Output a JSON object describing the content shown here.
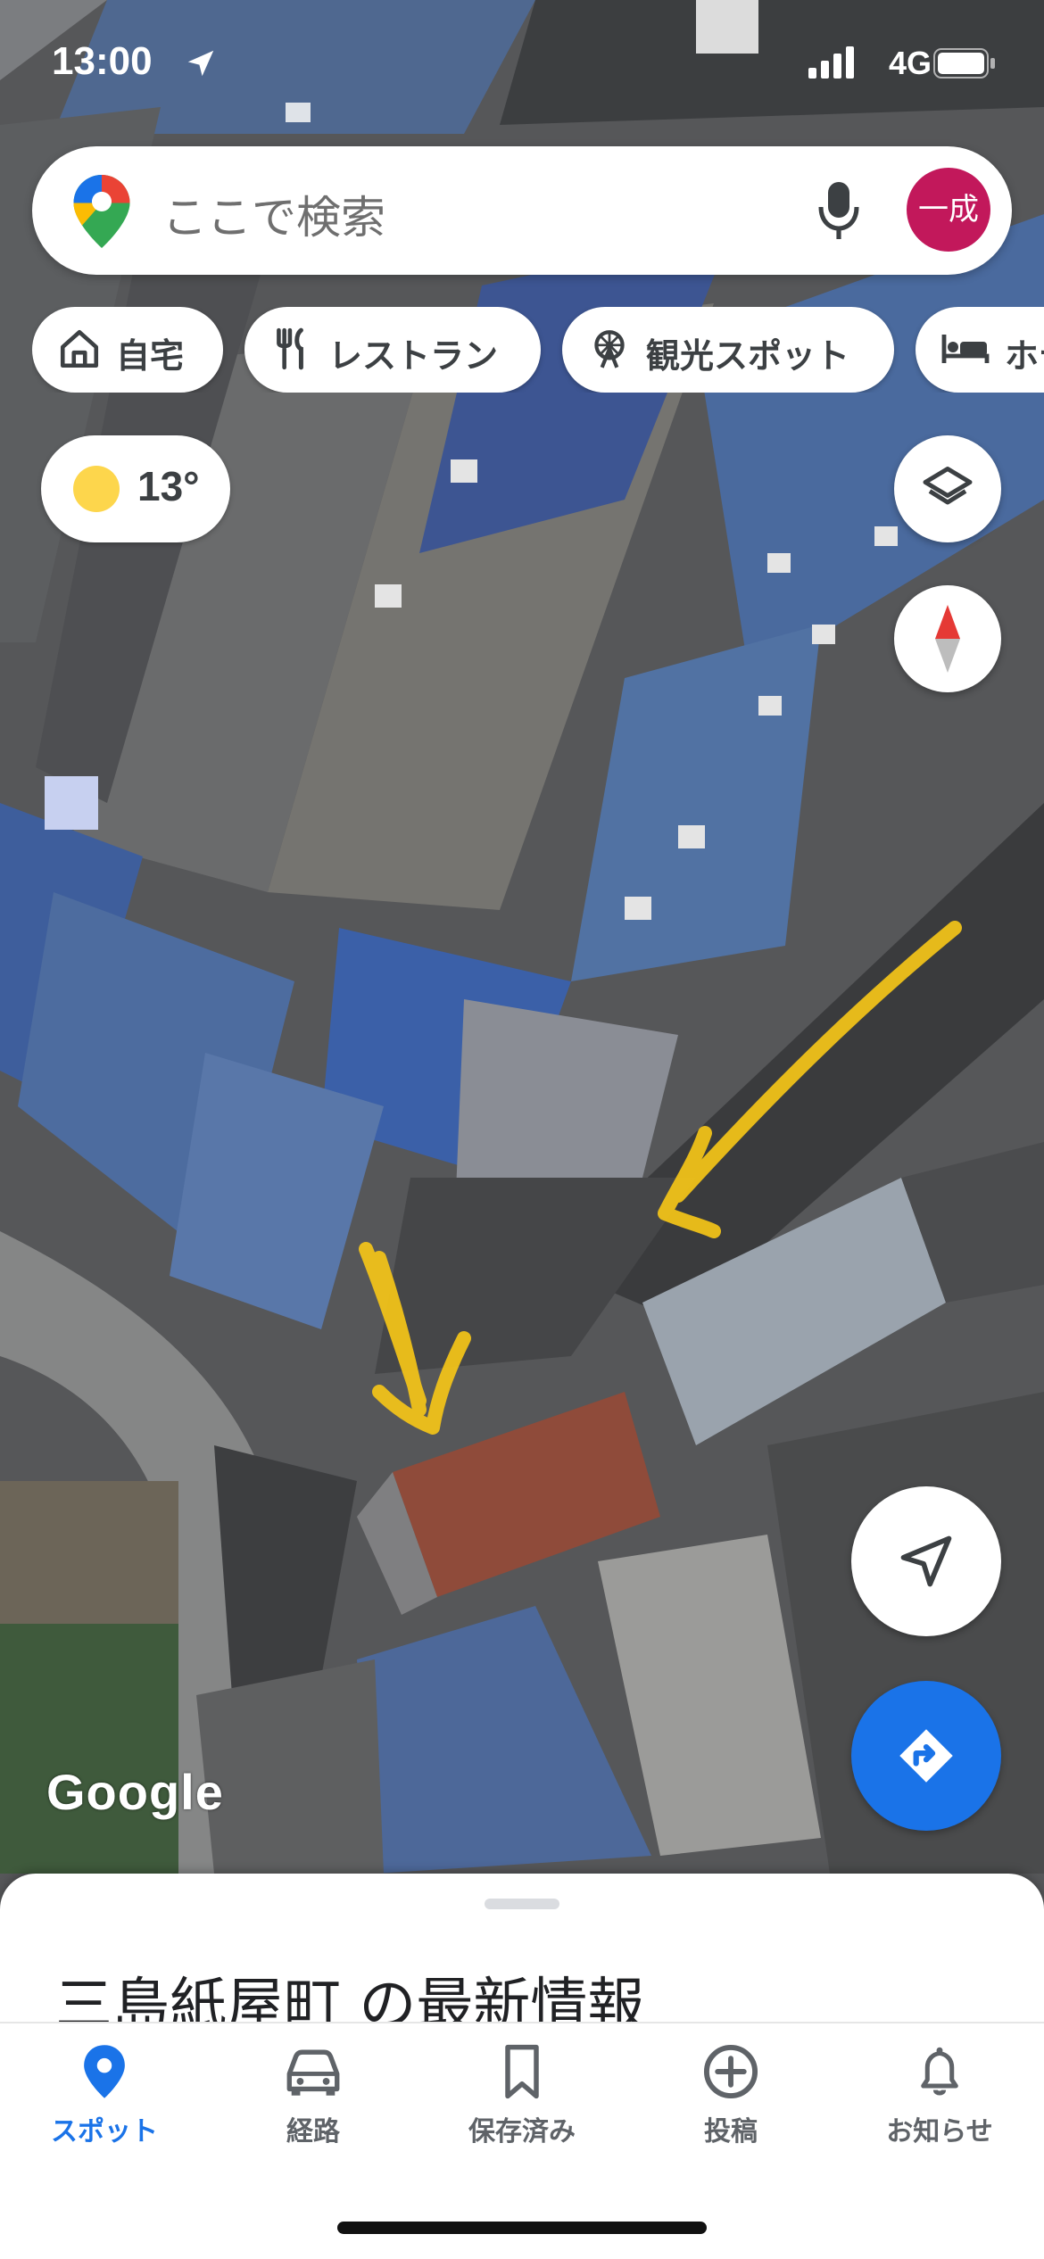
{
  "status_bar": {
    "time": "13:00",
    "network": "4G"
  },
  "search": {
    "placeholder": "ここで検索",
    "avatar_text": "一成",
    "logo_icon": "google-maps-pin-icon",
    "mic_icon": "microphone-icon"
  },
  "chips": [
    {
      "label": "自宅",
      "icon": "home-icon"
    },
    {
      "label": "レストラン",
      "icon": "restaurant-icon"
    },
    {
      "label": "観光スポット",
      "icon": "ferris-wheel-icon"
    },
    {
      "label": "ホテル",
      "icon": "hotel-bed-icon"
    }
  ],
  "weather": {
    "temperature": "13°",
    "icon": "sun-icon"
  },
  "map": {
    "attribution": "Google",
    "layer_type": "satellite"
  },
  "sheet": {
    "title": "三島紙屋町 の最新情報"
  },
  "bottom_nav": {
    "items": [
      {
        "label": "スポット",
        "icon": "location-pin-icon",
        "active": true
      },
      {
        "label": "経路",
        "icon": "car-icon",
        "active": false
      },
      {
        "label": "保存済み",
        "icon": "bookmark-icon",
        "active": false
      },
      {
        "label": "投稿",
        "icon": "add-circle-icon",
        "active": false
      },
      {
        "label": "お知らせ",
        "icon": "bell-icon",
        "active": false
      }
    ]
  },
  "colors": {
    "accent_blue": "#1a73e8",
    "avatar": "#c2185b",
    "sun": "#fdd64c",
    "annotation_arrows": "#f5c518"
  }
}
